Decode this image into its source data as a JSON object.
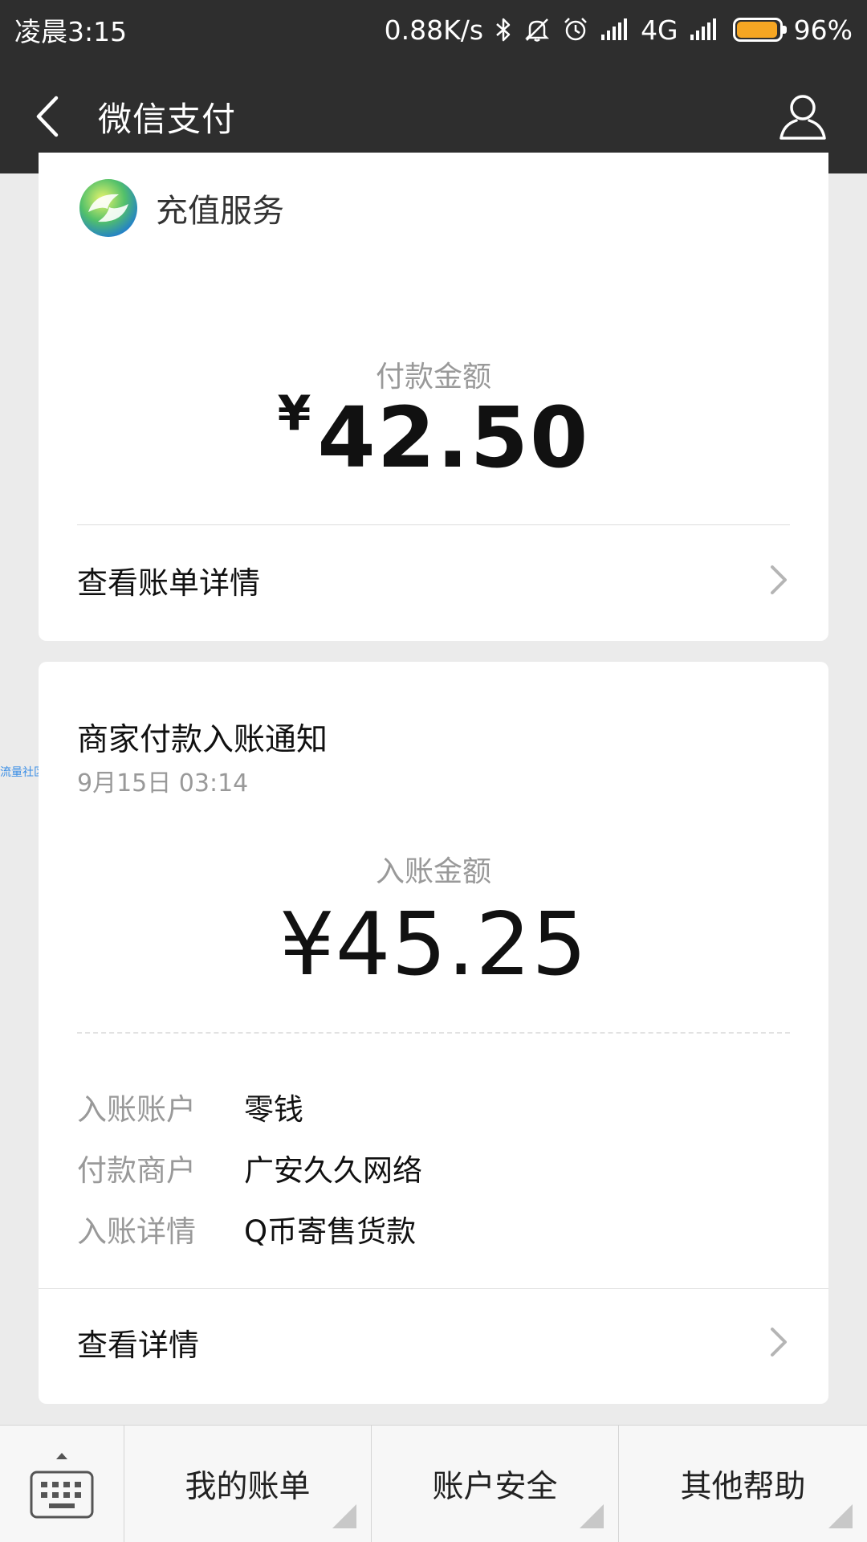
{
  "status_bar": {
    "time": "凌晨3:15",
    "net_speed": "0.88K/s",
    "network": "4G",
    "battery_percent_text": "96%",
    "battery_level": 0.96,
    "battery_color": "#f5a623"
  },
  "header": {
    "title": "微信支付",
    "back_icon": "back-arrow-icon",
    "profile_icon": "person-icon"
  },
  "payment_card": {
    "service_name": "充值服务",
    "amount_label": "付款金额",
    "currency": "¥",
    "amount": "42.50",
    "link_label": "查看账单详情"
  },
  "notice_card": {
    "title": "商家付款入账通知",
    "time": "9月15日  03:14",
    "amount_label": "入账金额",
    "amount": "¥45.25",
    "details": [
      {
        "key": "入账账户",
        "value": "零钱"
      },
      {
        "key": "付款商户",
        "value": "广安久久网络"
      },
      {
        "key": "入账详情",
        "value": "Q币寄售货款"
      }
    ],
    "link_label": "查看详情"
  },
  "watermark": "流量社区",
  "bottom_menu": {
    "keyboard_icon": "keyboard-icon",
    "items": [
      {
        "label": "我的账单"
      },
      {
        "label": "账户安全"
      },
      {
        "label": "其他帮助"
      }
    ]
  },
  "colors": {
    "header_bg": "#2e2e2e",
    "page_bg": "#ebebeb",
    "muted_text": "#999999"
  }
}
